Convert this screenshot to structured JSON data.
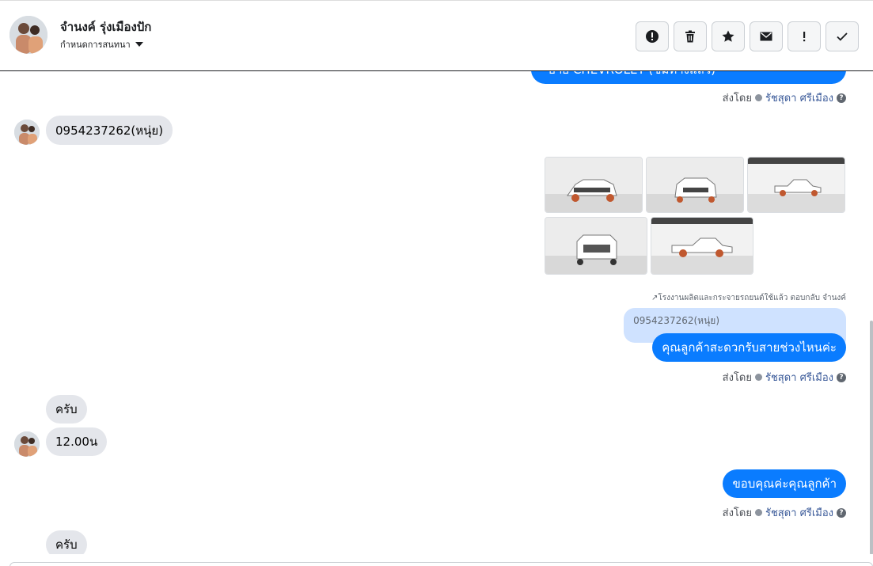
{
  "header": {
    "contact_name": "จำนงค์ รุ่งเมืองปัก",
    "assign_label": "กำหนดการสนทนา"
  },
  "actions": [
    {
      "name": "spam-icon"
    },
    {
      "name": "trash-icon"
    },
    {
      "name": "star-icon"
    },
    {
      "name": "envelope-icon"
    },
    {
      "name": "exclamation-icon"
    },
    {
      "name": "check-icon"
    }
  ],
  "messages": {
    "top_cut_text": "- ยาย CHEVROLET (ชมทางแลว)",
    "sent_by_label": "ส่งโดย",
    "agent_name": "รัชสุดา ศรีเมือง",
    "help_glyph": "?",
    "in_phone": "0954237262(หนุ่ย)",
    "reply_note": "↗โรงงานผลิตและกระจายรถยนต์ใช้แล้ว ตอบกลับ จำนงค์",
    "quoted_text": "0954237262(หนุ่ย)",
    "out_ask_time": "คุณลูกค้าสะดวกรับสายช่วงไหนค่ะ",
    "in_krap_1": "ครับ",
    "in_time": "12.00น",
    "out_thanks": "ขอบคุณค่ะคุณลูกค้า",
    "in_krap_2": "ครับ"
  },
  "colors": {
    "outgoing_bubble": "#0a7cff",
    "incoming_bubble": "#e4e6eb",
    "quoted_bubble": "#cfe2ff",
    "agent_link": "#385898"
  }
}
